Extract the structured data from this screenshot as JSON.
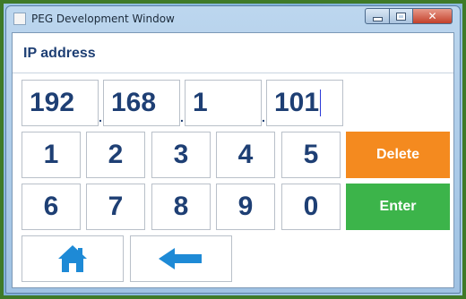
{
  "window": {
    "title": "PEG Development Window",
    "minimize_icon": "minimize-icon",
    "maximize_icon": "maximize-icon",
    "close_icon": "close-icon"
  },
  "header": {
    "label": "IP address"
  },
  "ip": {
    "octets": [
      "192",
      "168",
      "1",
      "101"
    ],
    "separator": "."
  },
  "keypad": {
    "row1": [
      "1",
      "2",
      "3",
      "4",
      "5"
    ],
    "row2": [
      "6",
      "7",
      "8",
      "9",
      "0"
    ]
  },
  "actions": {
    "delete_label": "Delete",
    "enter_label": "Enter",
    "delete_color": "#f48a1f",
    "enter_color": "#3cb44a"
  },
  "nav": {
    "home_icon": "home-icon",
    "back_icon": "back-arrow-icon",
    "icon_color": "#1e8ad6"
  }
}
